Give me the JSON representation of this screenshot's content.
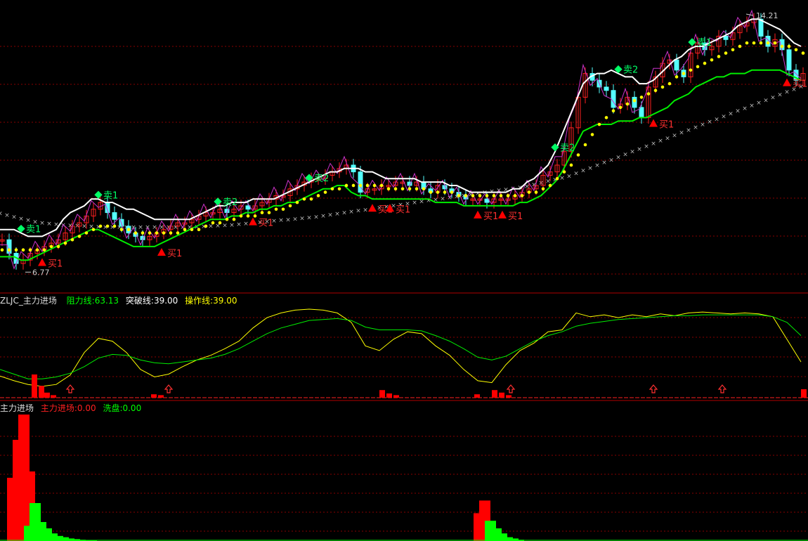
{
  "panels": {
    "indicator": {
      "name": "ZLJC_主力进场",
      "items": [
        {
          "label": "阻力线:",
          "value": "63.13",
          "color": "#00ff00"
        },
        {
          "label": "突破线:",
          "value": "39.00",
          "color": "#ffffff"
        },
        {
          "label": "操作线:",
          "value": "39.00",
          "color": "#ffff00"
        }
      ]
    },
    "volume": {
      "name": "主力进场",
      "items": [
        {
          "label": "主力进场:",
          "value": "0.00",
          "color": "#ff2020"
        },
        {
          "label": "洗盘:",
          "value": "0.00",
          "color": "#00ff00"
        }
      ]
    }
  },
  "colors": {
    "up": "#ff2020",
    "down": "#54ffff",
    "white": "#ffffff",
    "green": "#00ee00",
    "yellow": "#ffff00",
    "magenta": "#cc33cc",
    "gray": "#bbbbbb",
    "grid": "#8a0000",
    "separator": "#b00000"
  },
  "chart_data": [
    {
      "type": "line",
      "name": "price",
      "price_range": [
        6.77,
        14.21
      ],
      "price_labels": {
        "high": "14.21",
        "low": "6.77"
      },
      "x": [
        0,
        10,
        20,
        30,
        40,
        50,
        60,
        70,
        80,
        90,
        100,
        110,
        120,
        130,
        140,
        150,
        160,
        170,
        180,
        190,
        200,
        210,
        220,
        230,
        240,
        250,
        260,
        270,
        280,
        290,
        300,
        310,
        320,
        330,
        340,
        350,
        360,
        370,
        380,
        390,
        400,
        410,
        420,
        430,
        440,
        450,
        460,
        470,
        480,
        490,
        500,
        510,
        520,
        530,
        540,
        550,
        560,
        570,
        580,
        590,
        600,
        610,
        620,
        630,
        640,
        650,
        660,
        670,
        680,
        690,
        700,
        710,
        720,
        730,
        740,
        750,
        760,
        770,
        780,
        790,
        800,
        810,
        820,
        830,
        840,
        850,
        860,
        870,
        880,
        890,
        900,
        910,
        920,
        930,
        940,
        950,
        960,
        970,
        980,
        990,
        1000,
        1010,
        1020,
        1030,
        1040,
        1050,
        1060,
        1070,
        1080,
        1090,
        1100,
        1110,
        1120,
        1130,
        1140
      ],
      "close": [
        7.6,
        7.2,
        6.9,
        7.0,
        7.2,
        7.3,
        7.4,
        7.5,
        7.6,
        7.8,
        8.0,
        8.1,
        8.3,
        8.5,
        8.7,
        8.4,
        8.2,
        8.0,
        7.8,
        7.7,
        7.6,
        7.7,
        7.8,
        7.9,
        8.0,
        8.1,
        8.1,
        8.2,
        8.3,
        8.4,
        8.4,
        8.5,
        8.4,
        8.5,
        8.6,
        8.5,
        8.6,
        8.7,
        8.8,
        8.9,
        8.9,
        9.1,
        9.2,
        9.3,
        9.4,
        9.4,
        9.5,
        9.6,
        9.7,
        9.8,
        9.6,
        9.0,
        9.1,
        9.1,
        9.2,
        9.2,
        9.3,
        9.3,
        9.2,
        9.3,
        9.1,
        9.0,
        9.2,
        9.1,
        9.0,
        8.9,
        8.8,
        8.8,
        8.8,
        8.7,
        8.8,
        8.8,
        8.8,
        8.9,
        9.0,
        9.1,
        9.2,
        9.5,
        9.6,
        9.8,
        10.2,
        10.9,
        11.8,
        12.5,
        12.3,
        12.1,
        12.0,
        11.5,
        11.6,
        11.8,
        11.5,
        11.2,
        12.1,
        12.4,
        12.8,
        12.9,
        12.6,
        12.4,
        13.1,
        13.4,
        13.2,
        13.3,
        13.6,
        13.5,
        13.7,
        13.9,
        14.0,
        14.1,
        13.6,
        13.3,
        13.5,
        13.2,
        12.6,
        12.3,
        12.5
      ],
      "upper": [
        7.9,
        7.9,
        7.9,
        7.8,
        7.7,
        7.7,
        7.7,
        7.8,
        7.9,
        8.2,
        8.4,
        8.5,
        8.6,
        8.8,
        8.8,
        8.7,
        8.7,
        8.6,
        8.5,
        8.5,
        8.4,
        8.3,
        8.2,
        8.2,
        8.2,
        8.2,
        8.2,
        8.2,
        8.3,
        8.4,
        8.5,
        8.6,
        8.6,
        8.7,
        8.7,
        8.7,
        8.8,
        8.8,
        8.8,
        8.8,
        8.9,
        9.0,
        9.1,
        9.2,
        9.3,
        9.4,
        9.5,
        9.6,
        9.6,
        9.7,
        9.7,
        9.7,
        9.6,
        9.6,
        9.5,
        9.4,
        9.4,
        9.4,
        9.4,
        9.4,
        9.3,
        9.3,
        9.3,
        9.3,
        9.2,
        9.2,
        9.1,
        9.0,
        9.0,
        9.0,
        9.0,
        9.0,
        9.0,
        9.1,
        9.1,
        9.3,
        9.4,
        9.6,
        9.8,
        10.2,
        10.7,
        11.2,
        11.7,
        12.2,
        12.4,
        12.5,
        12.5,
        12.6,
        12.5,
        12.4,
        12.4,
        12.2,
        12.2,
        12.3,
        12.5,
        12.7,
        12.9,
        13.0,
        13.2,
        13.3,
        13.3,
        13.4,
        13.5,
        13.6,
        13.7,
        13.9,
        14.0,
        14.1,
        14.1,
        14.0,
        13.9,
        13.8,
        13.6,
        13.4,
        13.3
      ],
      "lower": [
        7.1,
        7.1,
        7.1,
        7.0,
        7.0,
        7.1,
        7.2,
        7.3,
        7.4,
        7.5,
        7.6,
        7.7,
        7.8,
        7.9,
        7.9,
        7.8,
        7.7,
        7.6,
        7.5,
        7.4,
        7.4,
        7.4,
        7.4,
        7.5,
        7.6,
        7.7,
        7.8,
        7.9,
        8.0,
        8.1,
        8.2,
        8.2,
        8.2,
        8.3,
        8.3,
        8.4,
        8.4,
        8.5,
        8.5,
        8.6,
        8.6,
        8.7,
        8.7,
        8.8,
        8.9,
        9.0,
        9.1,
        9.1,
        9.2,
        9.2,
        9.0,
        8.9,
        8.9,
        8.8,
        8.8,
        8.8,
        8.8,
        8.8,
        8.8,
        8.8,
        8.8,
        8.8,
        8.7,
        8.7,
        8.7,
        8.7,
        8.6,
        8.6,
        8.6,
        8.6,
        8.6,
        8.6,
        8.6,
        8.6,
        8.7,
        8.7,
        8.8,
        8.9,
        9.1,
        9.3,
        9.6,
        10.0,
        10.4,
        10.8,
        10.9,
        11.0,
        11.0,
        11.0,
        11.1,
        11.1,
        11.1,
        11.2,
        11.2,
        11.3,
        11.4,
        11.5,
        11.7,
        11.8,
        11.9,
        12.1,
        12.2,
        12.3,
        12.4,
        12.4,
        12.5,
        12.5,
        12.5,
        12.6,
        12.6,
        12.6,
        12.6,
        12.6,
        12.5,
        12.4,
        12.3
      ],
      "ma": [
        7.3,
        7.3,
        7.3,
        7.3,
        7.3,
        7.3,
        7.3,
        7.4,
        7.4,
        7.5,
        7.6,
        7.7,
        7.8,
        7.9,
        8.0,
        8.0,
        8.0,
        7.9,
        7.9,
        7.8,
        7.8,
        7.8,
        7.8,
        7.8,
        7.8,
        7.8,
        7.9,
        7.9,
        7.9,
        8.0,
        8.1,
        8.1,
        8.2,
        8.2,
        8.3,
        8.3,
        8.3,
        8.4,
        8.4,
        8.5,
        8.5,
        8.6,
        8.7,
        8.8,
        8.8,
        8.9,
        9.0,
        9.1,
        9.1,
        9.2,
        9.2,
        9.2,
        9.2,
        9.2,
        9.2,
        9.1,
        9.1,
        9.1,
        9.1,
        9.1,
        9.1,
        9.0,
        9.0,
        9.0,
        9.0,
        8.9,
        8.9,
        8.9,
        8.9,
        8.9,
        8.9,
        8.9,
        8.9,
        8.9,
        8.9,
        9.0,
        9.0,
        9.1,
        9.2,
        9.4,
        9.6,
        9.8,
        10.1,
        10.4,
        10.7,
        11.0,
        11.2,
        11.4,
        11.5,
        11.6,
        11.7,
        11.8,
        11.9,
        12.0,
        12.1,
        12.2,
        12.4,
        12.5,
        12.6,
        12.7,
        12.8,
        12.9,
        13.0,
        13.1,
        13.2,
        13.3,
        13.4,
        13.4,
        13.4,
        13.4,
        13.4,
        13.3,
        13.3,
        13.2,
        13.1
      ],
      "trend": [
        8.4,
        8.35,
        8.3,
        8.25,
        8.2,
        8.15,
        8.12,
        8.1,
        8.08,
        8.06,
        8.05,
        8.04,
        8.03,
        8.02,
        8.01,
        8.0,
        8.0,
        8.0,
        8.0,
        8.0,
        8.0,
        8.0,
        8.0,
        8.0,
        8.0,
        8.0,
        8.0,
        8.0,
        8.01,
        8.02,
        8.03,
        8.04,
        8.05,
        8.06,
        8.08,
        8.1,
        8.12,
        8.14,
        8.16,
        8.18,
        8.2,
        8.22,
        8.24,
        8.26,
        8.28,
        8.3,
        8.33,
        8.36,
        8.39,
        8.42,
        8.45,
        8.48,
        8.51,
        8.54,
        8.57,
        8.6,
        8.63,
        8.66,
        8.69,
        8.72,
        8.75,
        8.78,
        8.81,
        8.84,
        8.87,
        8.9,
        8.93,
        8.96,
        8.99,
        9.02,
        9.05,
        9.08,
        9.11,
        9.14,
        9.17,
        9.2,
        9.25,
        9.3,
        9.35,
        9.4,
        9.45,
        9.5,
        9.58,
        9.66,
        9.74,
        9.82,
        9.9,
        9.98,
        10.06,
        10.14,
        10.22,
        10.3,
        10.38,
        10.46,
        10.54,
        10.62,
        10.7,
        10.78,
        10.86,
        10.94,
        11.02,
        11.1,
        11.18,
        11.26,
        11.34,
        11.42,
        11.5,
        11.58,
        11.66,
        11.74,
        11.82,
        11.9,
        11.98,
        12.06,
        12.14
      ],
      "signals": [
        {
          "x": 30,
          "type": "sell",
          "text": "卖1"
        },
        {
          "x": 60,
          "type": "buy",
          "text": "买1"
        },
        {
          "x": 140,
          "type": "sell",
          "text": "卖1"
        },
        {
          "x": 230,
          "type": "buy",
          "text": "买1"
        },
        {
          "x": 310,
          "type": "sell",
          "text": "卖2"
        },
        {
          "x": 360,
          "type": "buy",
          "text": "买1"
        },
        {
          "x": 440,
          "type": "sell",
          "text": "卖2"
        },
        {
          "x": 530,
          "type": "buy",
          "text": "买1"
        },
        {
          "x": 555,
          "type": "buy",
          "text": "买1"
        },
        {
          "x": 680,
          "type": "buy",
          "text": "买1"
        },
        {
          "x": 715,
          "type": "buy",
          "text": "买1"
        },
        {
          "x": 790,
          "type": "sell",
          "text": "卖2"
        },
        {
          "x": 880,
          "type": "sell",
          "text": "卖2"
        },
        {
          "x": 930,
          "type": "buy",
          "text": "买1"
        },
        {
          "x": 985,
          "type": "sell",
          "text": "卖1"
        },
        {
          "x": 1120,
          "type": "buy",
          "text": "买1"
        }
      ]
    },
    {
      "type": "line",
      "name": "ZLJC_主力进场",
      "ylim": [
        0,
        100
      ],
      "x": [
        0,
        20,
        40,
        60,
        80,
        100,
        120,
        140,
        160,
        180,
        200,
        220,
        240,
        260,
        280,
        300,
        320,
        340,
        360,
        380,
        400,
        420,
        440,
        460,
        480,
        500,
        520,
        540,
        560,
        580,
        600,
        620,
        640,
        660,
        680,
        700,
        720,
        740,
        760,
        780,
        800,
        820,
        840,
        860,
        880,
        900,
        920,
        940,
        960,
        980,
        1000,
        1020,
        1040,
        1060,
        1080,
        1100,
        1120,
        1140
      ],
      "yellow": [
        23,
        18,
        14,
        12,
        14,
        24,
        48,
        63,
        60,
        48,
        30,
        22,
        25,
        33,
        40,
        45,
        52,
        60,
        74,
        85,
        90,
        93,
        94,
        93,
        90,
        80,
        55,
        50,
        62,
        70,
        68,
        55,
        45,
        30,
        18,
        16,
        35,
        50,
        58,
        70,
        72,
        90,
        86,
        88,
        85,
        88,
        86,
        89,
        87,
        90,
        91,
        90,
        89,
        90,
        89,
        86,
        62,
        38
      ],
      "green": [
        30,
        25,
        20,
        20,
        22,
        26,
        33,
        42,
        46,
        45,
        40,
        37,
        36,
        38,
        40,
        42,
        46,
        52,
        60,
        68,
        74,
        78,
        82,
        83,
        84,
        82,
        75,
        72,
        72,
        72,
        71,
        66,
        60,
        52,
        43,
        40,
        44,
        52,
        60,
        66,
        70,
        76,
        79,
        81,
        83,
        84,
        85,
        86,
        87,
        87,
        88,
        88,
        88,
        88,
        88,
        86,
        80,
        66
      ],
      "bars": [
        {
          "x": 45,
          "v": 55
        },
        {
          "x": 55,
          "v": 28
        },
        {
          "x": 63,
          "v": 12
        },
        {
          "x": 72,
          "v": 6
        },
        {
          "x": 215,
          "v": 8
        },
        {
          "x": 225,
          "v": 6
        },
        {
          "x": 540,
          "v": 18
        },
        {
          "x": 550,
          "v": 10
        },
        {
          "x": 560,
          "v": 6
        },
        {
          "x": 675,
          "v": 8
        },
        {
          "x": 700,
          "v": 18
        },
        {
          "x": 710,
          "v": 12
        },
        {
          "x": 720,
          "v": 6
        },
        {
          "x": 1140,
          "v": 20
        }
      ],
      "arrows_x": [
        100,
        240,
        727,
        930,
        1028
      ]
    },
    {
      "type": "bar",
      "name": "主力进场",
      "ylim": [
        0,
        100
      ],
      "x": [
        18,
        26,
        34,
        42,
        50,
        58,
        66,
        74,
        82,
        90,
        98,
        106,
        114,
        122,
        130,
        682,
        690,
        698,
        706,
        714,
        722,
        730,
        738
      ],
      "main": [
        50,
        80,
        100,
        55,
        30,
        15,
        0,
        0,
        0,
        0,
        0,
        0,
        0,
        0,
        0,
        22,
        32,
        0,
        0,
        0,
        0,
        0,
        0
      ],
      "wash": [
        0,
        0,
        0,
        12,
        30,
        15,
        10,
        6,
        4,
        3,
        2,
        1.5,
        1,
        0.8,
        0.5,
        0,
        0,
        16,
        10,
        6,
        3,
        2,
        1
      ]
    }
  ]
}
